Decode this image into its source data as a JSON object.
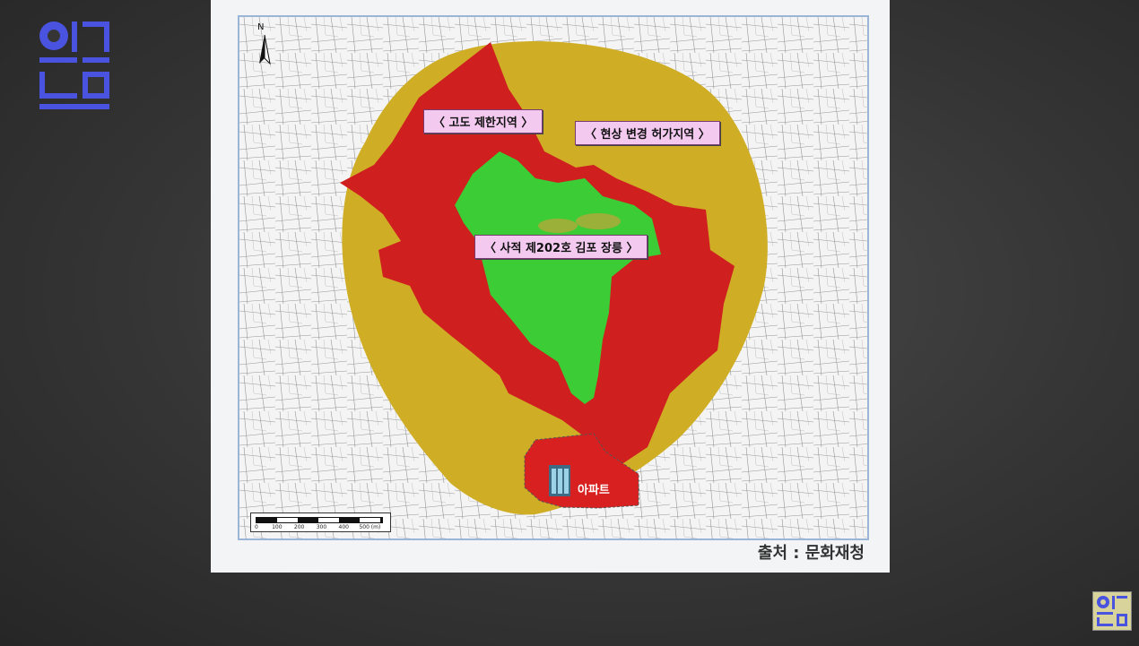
{
  "logo": {
    "lines": [
      "알",
      "고",
      "보",
      "면"
    ]
  },
  "map": {
    "zones": {
      "height_limit": "〈 고도 제한지역 〉",
      "change_permit": "〈 현상 변경 허가지역 〉",
      "site": "〈 사적 제202호 김포 장릉 〉",
      "apartment": "아파트"
    },
    "scale_ticks": [
      "0",
      "100",
      "200",
      "300",
      "400",
      "500 (m)"
    ],
    "north": "N",
    "source": "출처 : 문화재청"
  },
  "colors": {
    "change_permit_zone": "#cfae26",
    "height_limit_zone": "#cf1f1f",
    "site_zone": "#3ccc35",
    "apartment_zone": "#d92020",
    "logo": "#4a53e0"
  }
}
